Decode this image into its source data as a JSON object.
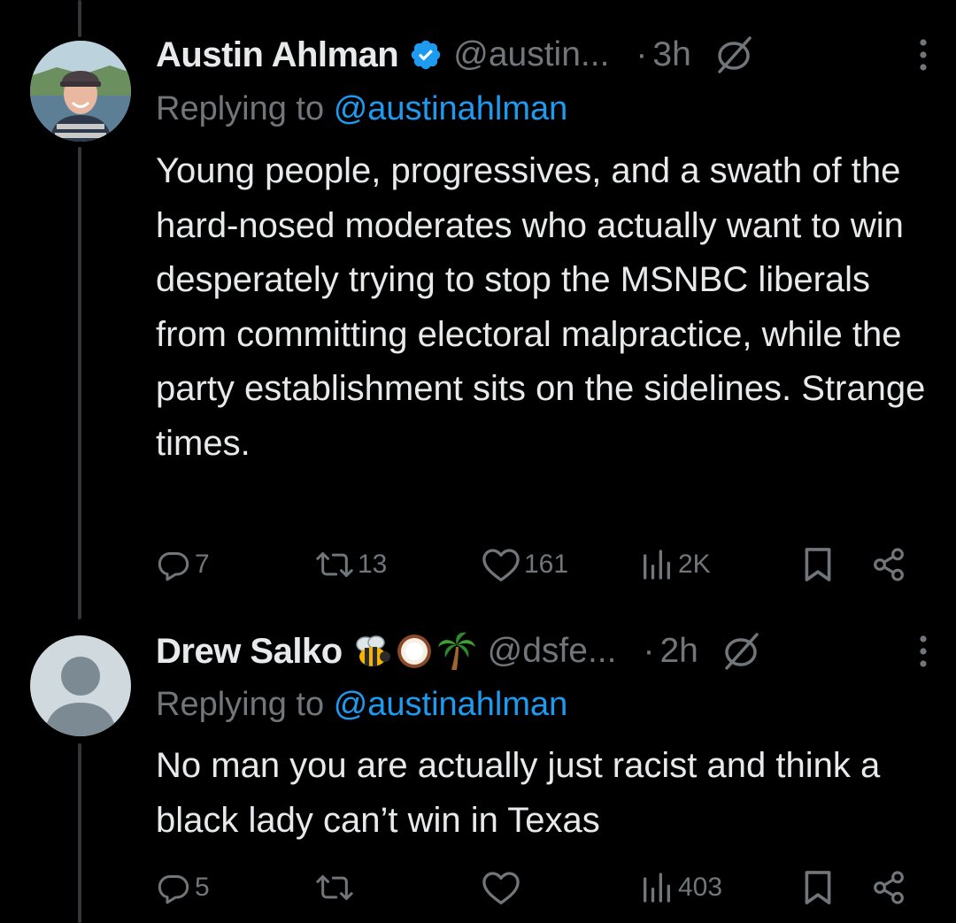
{
  "colors": {
    "background": "#000000",
    "text_primary": "#e7e9ea",
    "text_secondary": "#71767b",
    "accent": "#1d9bf0",
    "thread_line": "#333639"
  },
  "tweets": [
    {
      "author_name": "Austin Ahlman",
      "verified_icon": "verified-badge-icon",
      "handle": "@austin...",
      "separator": "·",
      "time": "3h",
      "replying_prefix": "Replying to",
      "replying_to": "@austinahlman",
      "text": "Young people, progressives, and a swath of the hard-nosed moderates who actually want to win desperately trying to stop the MSNBC liberals from committing electoral malpractice, while the party establishment sits on the sidelines. Strange times.",
      "replies": "7",
      "reposts": "13",
      "likes": "161",
      "views": "2K"
    },
    {
      "author_name": "Drew Salko",
      "name_emojis": [
        "bee-emoji",
        "coconut-emoji",
        "palm-tree-emoji"
      ],
      "handle": "@dsfe...",
      "separator": "·",
      "time": "2h",
      "replying_prefix": "Replying to",
      "replying_to": "@austinahlman",
      "text": "No man you are actually just racist and think a black lady can’t win in Texas",
      "replies": "5",
      "reposts": "",
      "likes": "",
      "views": "403"
    }
  ]
}
